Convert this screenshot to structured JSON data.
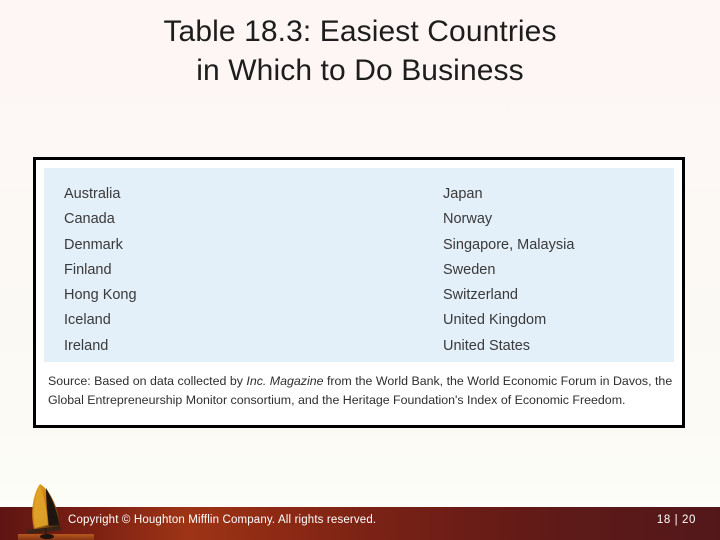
{
  "slide": {
    "title_line_1": "Table 18.3: Easiest Countries",
    "title_line_2": "in Which to Do Business",
    "background_color": "#fdf7f5"
  },
  "table": {
    "panel_color": "#e3eff9",
    "border_color": "#000000",
    "left_column": [
      "Australia",
      "Canada",
      "Denmark",
      "Finland",
      "Hong Kong",
      "Iceland",
      "Ireland"
    ],
    "right_column": [
      "Japan",
      "Norway",
      "Singapore, Malaysia",
      "Sweden",
      "Switzerland",
      "United Kingdom",
      "United States"
    ],
    "source": {
      "prefix": "Source: Based on data collected by ",
      "italic": "Inc. Magazine",
      "suffix": " from the World Bank, the World Economic Forum in Davos, the Global Entrepreneurship Monitor consortium, and the Heritage Foundation's Index of Economic Freedom."
    }
  },
  "footer": {
    "copyright": "Copyright © Houghton Mifflin Company. All rights reserved.",
    "page_number": "18 | 20",
    "bar_color_left": "#5e1513",
    "bar_color_mid": "#9e3415",
    "bar_color_right": "#53171a",
    "graphic_name": "hang-glider-graphic"
  }
}
